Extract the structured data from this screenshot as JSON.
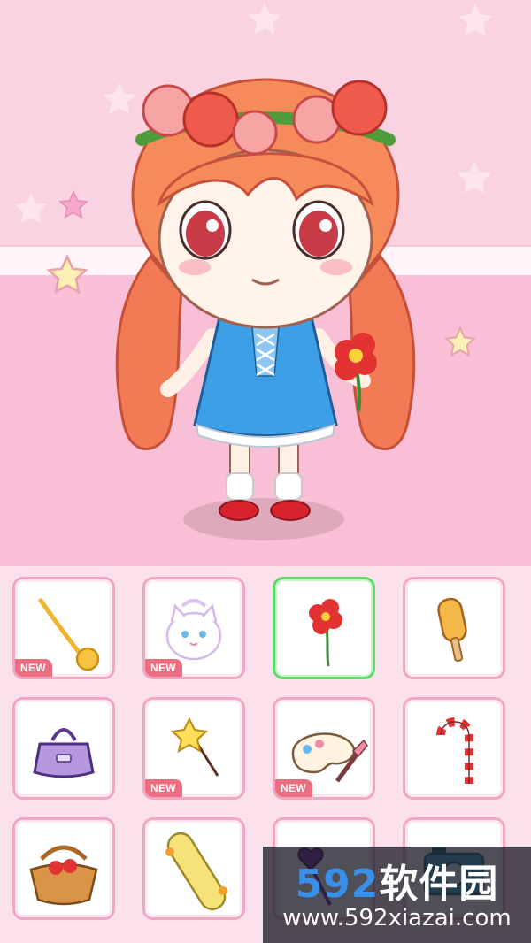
{
  "scene": {
    "colors": {
      "wall": "#fad3e2",
      "floor": "#f8bfd6",
      "panel": "#fbe1ec",
      "item_border": "#f2a6c4",
      "selected_border": "#5fd96a",
      "new_badge": "#ea6d80"
    }
  },
  "accessories": {
    "items": [
      {
        "icon": "necklace-icon",
        "badge": "NEW",
        "selected": false
      },
      {
        "icon": "cat-bag-icon",
        "badge": "NEW",
        "selected": false
      },
      {
        "icon": "red-flower-icon",
        "badge": "",
        "selected": true
      },
      {
        "icon": "popsicle-icon",
        "badge": "",
        "selected": false
      },
      {
        "icon": "purple-purse-icon",
        "badge": "",
        "selected": false
      },
      {
        "icon": "star-wand-icon",
        "badge": "NEW",
        "selected": false
      },
      {
        "icon": "paint-palette-icon",
        "badge": "NEW",
        "selected": false
      },
      {
        "icon": "candy-cane-icon",
        "badge": "",
        "selected": false
      },
      {
        "icon": "picnic-basket-icon",
        "badge": "",
        "selected": false
      },
      {
        "icon": "skateboard-icon",
        "badge": "",
        "selected": false
      },
      {
        "icon": "heart-wand-icon",
        "badge": "",
        "selected": false
      },
      {
        "icon": "camera-icon",
        "badge": "",
        "selected": false
      }
    ]
  },
  "watermark": {
    "logo_number": "592",
    "logo_text": "软件园",
    "url": "www.592xiazai.com"
  }
}
